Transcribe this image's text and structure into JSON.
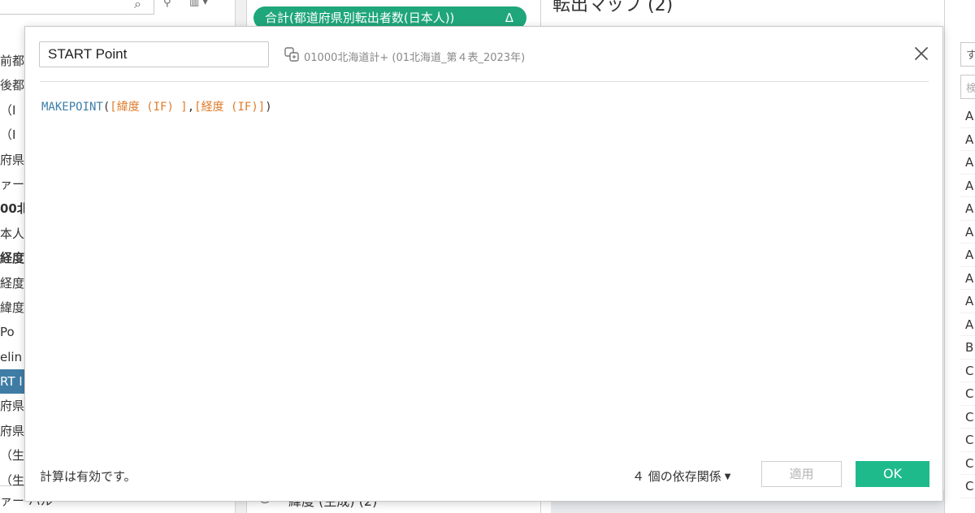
{
  "left_panel": {
    "rows": [
      "前都",
      "後都",
      "（I",
      "（I",
      "府県",
      "ァース",
      "00北",
      "本人",
      "経度",
      "経度",
      "緯度",
      "Po",
      "elin",
      "RT I",
      "府県",
      "府県",
      "（生",
      "（生"
    ],
    "bold_rows": [
      6,
      8
    ],
    "selected_row": 13,
    "bottom_text": "ァー ハル"
  },
  "middle_panel": {
    "pill_label": "合計(都道府県別転出者数(日本人))",
    "pill_delta": "Δ",
    "bottom_text": "緯度 (生成) (2)"
  },
  "sheet": {
    "title": "転出マップ (2)"
  },
  "right_panel": {
    "top_char": "す",
    "search_placeholder": "検",
    "rows": [
      "A",
      "A",
      "A",
      "A",
      "A",
      "A",
      "A",
      "A",
      "A",
      "A",
      "B",
      "C",
      "C",
      "C",
      "C",
      "C",
      "C"
    ]
  },
  "dialog": {
    "calc_name": "START Point",
    "datasource": "01000北海道計+ (01北海道_第４表_2023年)",
    "formula": {
      "function": "MAKEPOINT",
      "open": "(",
      "arg1": "[緯度 (IF) ]",
      "sep": ",",
      "arg2": "[経度 (IF)]",
      "close": ")"
    },
    "status": "計算は有効です。",
    "dependencies": "４ 個の依存関係",
    "apply_label": "適用",
    "ok_label": "OK"
  },
  "colors": {
    "accent_green": "#1fba8c",
    "pill_green": "#1fa67a",
    "selection_blue": "#3f7da6",
    "function_blue": "#3d7ea6",
    "field_orange": "#e07b2a"
  }
}
